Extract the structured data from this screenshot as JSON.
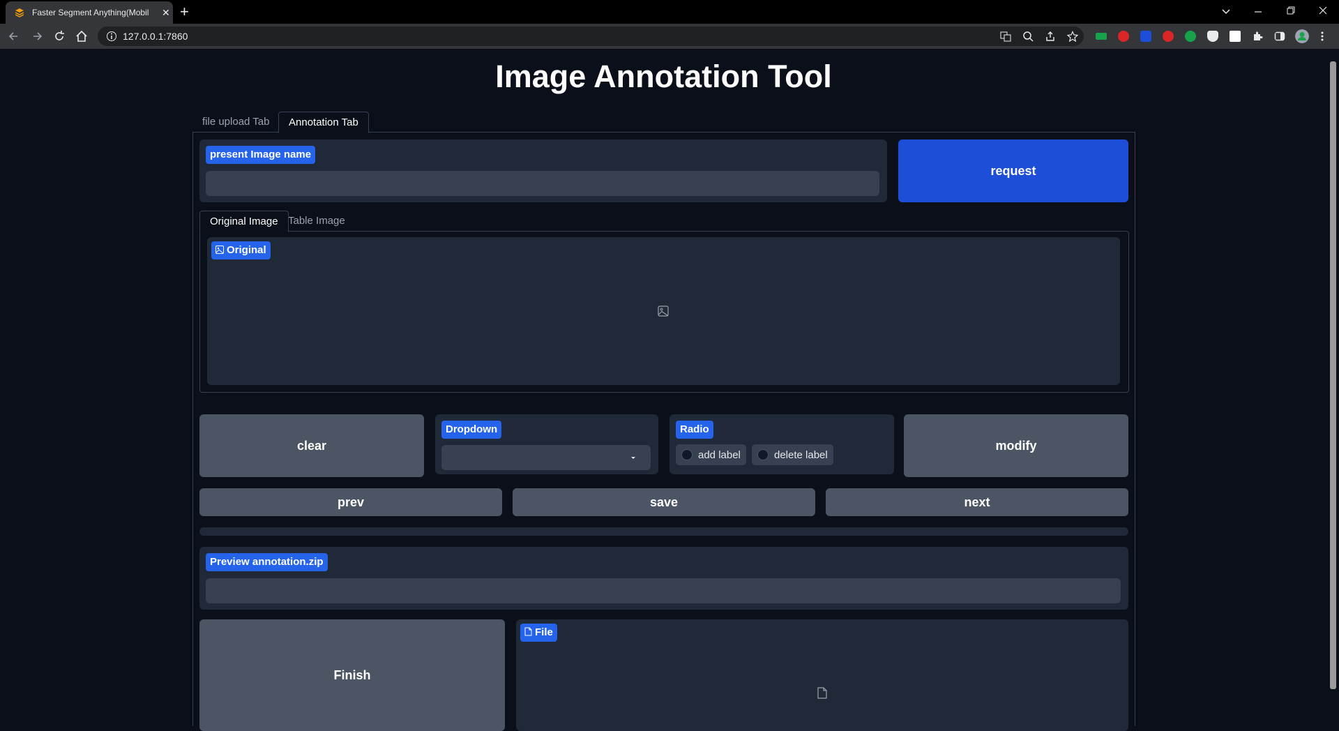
{
  "browser": {
    "tab_title": "Faster Segment Anything(Mobil",
    "url": "127.0.0.1:7860",
    "new_tab_glyph": "+",
    "close_glyph": "✕"
  },
  "app": {
    "title": "Image Annotation Tool",
    "tabs": [
      {
        "label": "file upload Tab",
        "active": false
      },
      {
        "label": "Annotation Tab",
        "active": true
      }
    ],
    "present_image": {
      "label": "present Image name",
      "value": ""
    },
    "request_button": "request",
    "image_tabs": [
      {
        "label": "Original Image",
        "active": true
      },
      {
        "label": "Table Image",
        "active": false
      }
    ],
    "original_image": {
      "label": "Original",
      "icon": "image-icon"
    },
    "clear_button": "clear",
    "dropdown": {
      "label": "Dropdown",
      "value": ""
    },
    "radio": {
      "label": "Radio",
      "options": [
        "add label",
        "delete label"
      ]
    },
    "modify_button": "modify",
    "prev_button": "prev",
    "save_button": "save",
    "next_button": "next",
    "preview": {
      "label": "Preview annotation.zip",
      "value": ""
    },
    "finish_button": "Finish",
    "file": {
      "label": "File",
      "icon": "file-icon"
    }
  },
  "colors": {
    "background": "#0b0f19",
    "block": "#1f2937",
    "label_chip": "#2563eb",
    "primary_button": "#1d4ed8",
    "secondary_button": "#4b5563"
  }
}
